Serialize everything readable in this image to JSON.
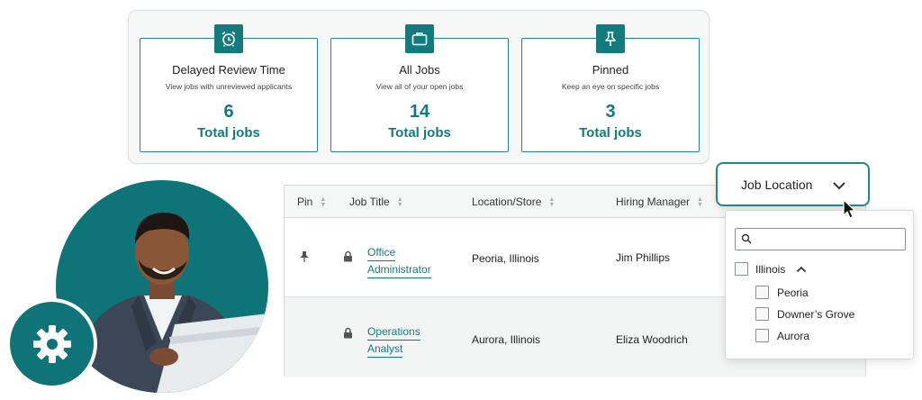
{
  "stats": [
    {
      "icon": "alarm-clock-icon",
      "title": "Delayed Review Time",
      "desc": "View jobs with unreviewed applicants",
      "count": "6",
      "unit": "Total jobs"
    },
    {
      "icon": "briefcase-icon",
      "title": "All Jobs",
      "desc": "View all of your open jobs",
      "count": "14",
      "unit": "Total jobs"
    },
    {
      "icon": "pin-icon",
      "title": "Pinned",
      "desc": "Keep an eye on specific jobs",
      "count": "3",
      "unit": "Total jobs"
    }
  ],
  "table": {
    "headers": [
      "Pin",
      "Job Title",
      "Location/Store",
      "Hiring Manager"
    ],
    "rows": [
      {
        "pinned": true,
        "locked": true,
        "title_line1": "Office",
        "title_line2": "Administrator",
        "location": "Peoria, Illinois",
        "manager": "Jim Phillips"
      },
      {
        "pinned": false,
        "locked": true,
        "title_line1": "Operations",
        "title_line2": "Analyst",
        "location": "Aurora, Illinois",
        "manager": "Eliza Woodrich"
      }
    ]
  },
  "location_filter": {
    "button_label": "Job Location",
    "search_value": "",
    "state": "Illinois",
    "cities": [
      "Peoria",
      "Downer’s Grove",
      "Aurora"
    ]
  },
  "colors": {
    "accent": "#137a7e",
    "accent_border": "#22888c"
  }
}
